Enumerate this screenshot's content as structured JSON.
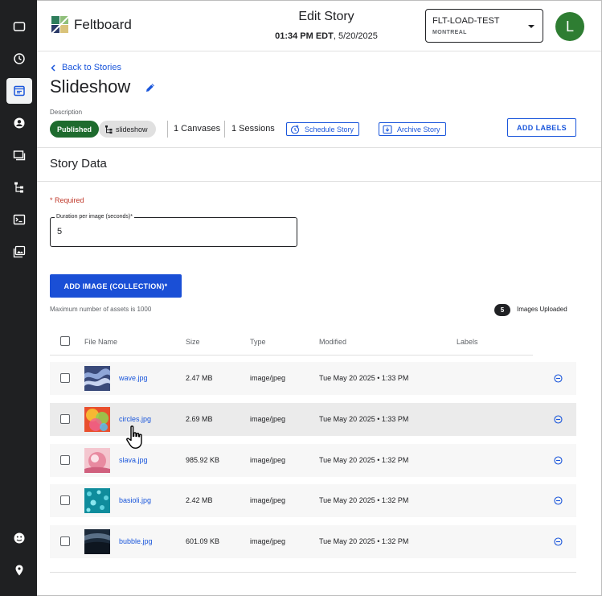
{
  "app": {
    "name": "Feltboard",
    "brand_color": "#1a56db",
    "rail_icons": [
      "tv-icon",
      "clock-icon",
      "stories-icon",
      "account-icon",
      "canvases-icon",
      "hierarchy-icon",
      "terminal-icon",
      "media-icon",
      "smiley-icon",
      "location-icon"
    ],
    "active_rail_item": "stories-icon"
  },
  "header": {
    "title": "Edit Story",
    "time": "01:34 PM EDT",
    "date": ", 5/20/2025",
    "org_name": "FLT-LOAD-TEST",
    "org_location": "MONTREAL",
    "avatar_initial": "L"
  },
  "story": {
    "back_label": "Back to Stories",
    "title": "Slideshow",
    "description_label": "Description",
    "status": "Published",
    "type_chip": "slideshow",
    "canvases": "1 Canvases",
    "sessions": "1 Sessions",
    "schedule_label": "Schedule Story",
    "archive_label": "Archive Story",
    "add_labels": "ADD LABELS"
  },
  "story_data": {
    "section_title": "Story Data",
    "required_note": "* Required",
    "duration_label": "Duration per image (seconds)*",
    "duration_value": "5",
    "add_image_label": "ADD IMAGE (COLLECTION)*",
    "max_assets_note": "Maximum number of assets is 1000",
    "uploaded_count": "5",
    "uploaded_label": "Images Uploaded"
  },
  "table": {
    "columns": [
      "File Name",
      "Size",
      "Type",
      "Modified",
      "Labels"
    ],
    "rows": [
      {
        "name": "wave.jpg",
        "size": "2.47 MB",
        "type": "image/jpeg",
        "modified": "Tue May 20 2025 • 1:33 PM"
      },
      {
        "name": "circles.jpg",
        "size": "2.69 MB",
        "type": "image/jpeg",
        "modified": "Tue May 20 2025 • 1:33 PM"
      },
      {
        "name": "slava.jpg",
        "size": "985.92 KB",
        "type": "image/jpeg",
        "modified": "Tue May 20 2025 • 1:32 PM"
      },
      {
        "name": "basioli.jpg",
        "size": "2.42 MB",
        "type": "image/jpeg",
        "modified": "Tue May 20 2025 • 1:32 PM"
      },
      {
        "name": "bubble.jpg",
        "size": "601.09 KB",
        "type": "image/jpeg",
        "modified": "Tue May 20 2025 • 1:32 PM"
      }
    ]
  }
}
